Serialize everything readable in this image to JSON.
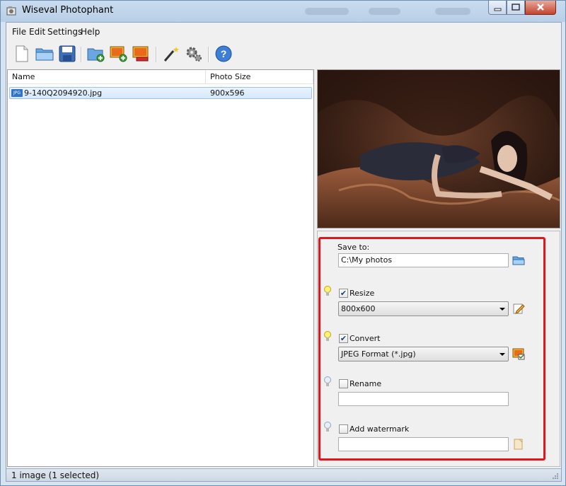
{
  "window": {
    "title": "Wiseval Photophant"
  },
  "menu": {
    "items": [
      "File",
      "Edit",
      "Settings",
      "Help"
    ]
  },
  "toolbar": {
    "buttons": [
      {
        "icon": "new-file-icon"
      },
      {
        "icon": "open-folder-icon"
      },
      {
        "icon": "save-icon"
      },
      {
        "icon": "add-folder-icon"
      },
      {
        "icon": "add-images-icon"
      },
      {
        "icon": "remove-image-icon"
      },
      {
        "icon": "magic-wand-icon"
      },
      {
        "icon": "gear-icon"
      },
      {
        "icon": "help-icon"
      }
    ]
  },
  "list": {
    "columns": [
      "Name",
      "Photo Size"
    ],
    "rows": [
      {
        "badge": "JPG",
        "name": "9-140Q2094920.jpg",
        "size": "900x596"
      }
    ]
  },
  "settings": {
    "save_to_label": "Save to:",
    "save_to_value": "C:\\My photos",
    "resize_label": "Resize",
    "resize_checked": true,
    "resize_value": "800x600",
    "convert_label": "Convert",
    "convert_checked": true,
    "convert_value": "JPEG Format (*.jpg)",
    "rename_label": "Rename",
    "rename_checked": false,
    "rename_value": "",
    "watermark_label": "Add watermark",
    "watermark_checked": false,
    "watermark_value": ""
  },
  "status": {
    "text": "1 image (1 selected)"
  },
  "colors": {
    "highlight_box": "#e0151d",
    "titlebar": "#c9dbef",
    "selection": "#d6e8fb"
  }
}
